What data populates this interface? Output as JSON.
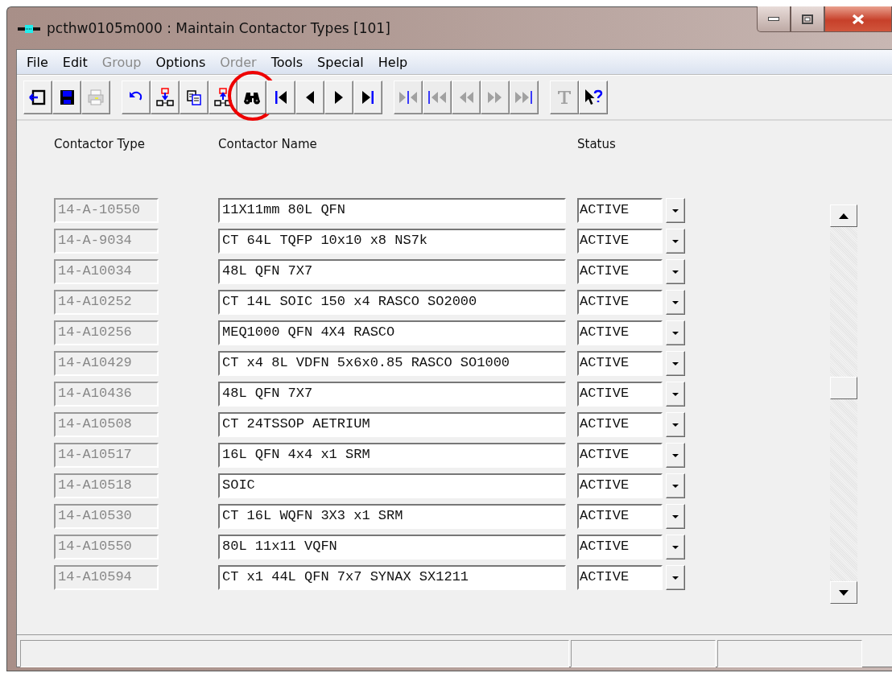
{
  "window": {
    "title": "pcthw0105m000 : Maintain Contactor Types [101]"
  },
  "menu": [
    {
      "label": "File",
      "disabled": false
    },
    {
      "label": "Edit",
      "disabled": false
    },
    {
      "label": "Group",
      "disabled": true
    },
    {
      "label": "Options",
      "disabled": false
    },
    {
      "label": "Order",
      "disabled": true
    },
    {
      "label": "Tools",
      "disabled": false
    },
    {
      "label": "Special",
      "disabled": false
    },
    {
      "label": "Help",
      "disabled": false
    }
  ],
  "toolbar": [
    [
      {
        "kind": "exit",
        "disabled": false,
        "highlighted": false
      },
      {
        "kind": "save",
        "disabled": false,
        "highlighted": false
      },
      {
        "kind": "print",
        "disabled": true,
        "highlighted": false
      }
    ],
    [
      {
        "kind": "undo",
        "disabled": false,
        "highlighted": false
      },
      {
        "kind": "insert-down",
        "disabled": false,
        "highlighted": false
      },
      {
        "kind": "copy",
        "disabled": false,
        "highlighted": false
      },
      {
        "kind": "insert-up",
        "disabled": false,
        "highlighted": false
      },
      {
        "kind": "find",
        "disabled": false,
        "highlighted": true
      },
      {
        "kind": "first",
        "disabled": false,
        "highlighted": false
      },
      {
        "kind": "prev",
        "disabled": false,
        "highlighted": false
      },
      {
        "kind": "next",
        "disabled": false,
        "highlighted": false
      },
      {
        "kind": "last",
        "disabled": false,
        "highlighted": false
      }
    ],
    [
      {
        "kind": "group-select",
        "disabled": true,
        "highlighted": false
      },
      {
        "kind": "group-first",
        "disabled": true,
        "highlighted": false
      },
      {
        "kind": "group-prev",
        "disabled": true,
        "highlighted": false
      },
      {
        "kind": "group-next",
        "disabled": true,
        "highlighted": false
      },
      {
        "kind": "group-last",
        "disabled": true,
        "highlighted": false
      }
    ],
    [
      {
        "kind": "text",
        "disabled": true,
        "highlighted": false
      },
      {
        "kind": "help",
        "disabled": false,
        "highlighted": false
      }
    ]
  ],
  "columns": [
    "Contactor Type",
    "Contactor Name",
    "Status"
  ],
  "rows": [
    {
      "type": "14-A-10550",
      "name": "11X11mm 80L QFN",
      "status": "ACTIVE"
    },
    {
      "type": "14-A-9034",
      "name": "CT 64L TQFP 10x10 x8 NS7k",
      "status": "ACTIVE"
    },
    {
      "type": "14-A10034",
      "name": "48L QFN 7X7",
      "status": "ACTIVE"
    },
    {
      "type": "14-A10252",
      "name": "CT 14L SOIC 150 x4 RASCO SO2000",
      "status": "ACTIVE"
    },
    {
      "type": "14-A10256",
      "name": "MEQ1000 QFN 4X4 RASCO",
      "status": "ACTIVE"
    },
    {
      "type": "14-A10429",
      "name": "CT x4 8L VDFN 5x6x0.85 RASCO SO1000",
      "status": "ACTIVE"
    },
    {
      "type": "14-A10436",
      "name": "48L QFN 7X7",
      "status": "ACTIVE"
    },
    {
      "type": "14-A10508",
      "name": "CT 24TSSOP AETRIUM",
      "status": "ACTIVE"
    },
    {
      "type": "14-A10517",
      "name": "16L QFN 4x4 x1 SRM",
      "status": "ACTIVE"
    },
    {
      "type": "14-A10518",
      "name": "SOIC",
      "status": "ACTIVE"
    },
    {
      "type": "14-A10530",
      "name": "CT 16L WQFN 3X3 x1 SRM",
      "status": "ACTIVE"
    },
    {
      "type": "14-A10550",
      "name": "80L 11x11 VQFN",
      "status": "ACTIVE"
    },
    {
      "type": "14-A10594",
      "name": "CT x1 44L QFN 7x7 SYNAX SX1211",
      "status": "ACTIVE"
    }
  ]
}
